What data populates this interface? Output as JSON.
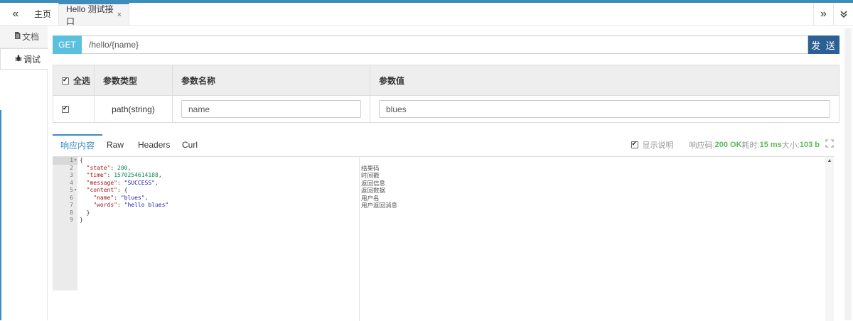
{
  "tabbar": {
    "back_icon": "«",
    "home_label": "主页",
    "active_tab_label": "Hello 测试接口",
    "close_icon": "×",
    "forward_icon": "»",
    "menu_icon": "⌄"
  },
  "sidebar": {
    "items": [
      {
        "label": "文档",
        "icon": "doc-icon"
      },
      {
        "label": "调试",
        "icon": "bug-icon"
      }
    ]
  },
  "request": {
    "method": "GET",
    "url": "/hello/{name}",
    "send_label": "发 送"
  },
  "params": {
    "headers": {
      "select_all": "全选",
      "type": "参数类型",
      "name": "参数名称",
      "value": "参数值"
    },
    "rows": [
      {
        "type": "path(string)",
        "name": "name",
        "value": "blues"
      }
    ]
  },
  "response": {
    "tabs": [
      "响应内容",
      "Raw",
      "Headers",
      "Curl"
    ],
    "show_desc_label": "显示说明",
    "status_label": "响应码:",
    "status_value": "200 OK",
    "time_label": "耗时:",
    "time_value": "15 ms",
    "size_label": "大小:",
    "size_value": "103 b",
    "line_numbers": [
      "1",
      "2",
      "3",
      "4",
      "5",
      "6",
      "7",
      "8",
      "9"
    ],
    "descriptions": [
      "",
      "结果码",
      "时间戳",
      "返回信息",
      "返回数据",
      "用户名",
      "用户返回消息",
      "",
      ""
    ]
  },
  "colors": {
    "accent": "#3c8dbc",
    "method_bg": "#5bc0de",
    "send_bg": "#2c5f94",
    "status_green": "#5cb85c"
  }
}
